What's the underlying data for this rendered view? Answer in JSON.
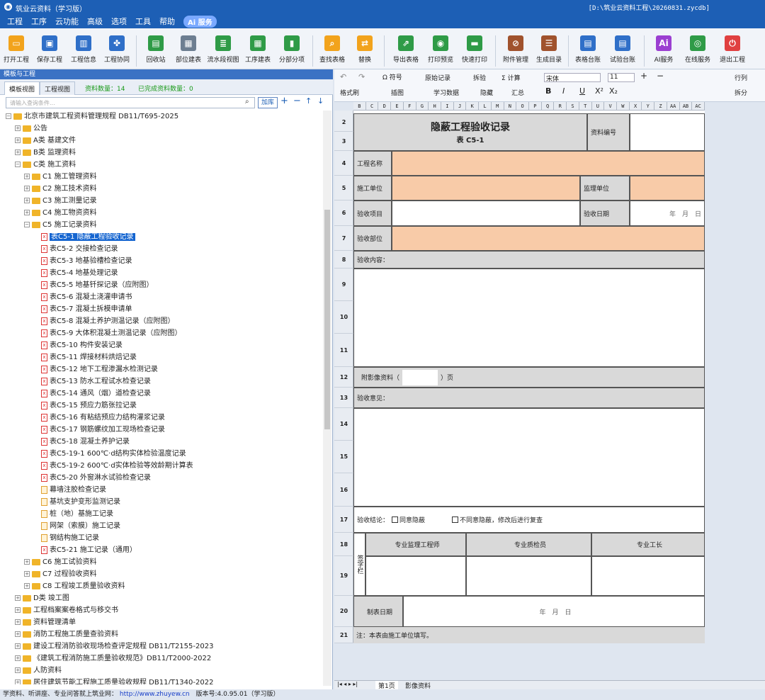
{
  "titlebar": {
    "title": "筑业云资料（学习版）",
    "path": "[D:\\筑业云资料工程\\20260831.zycdb]"
  },
  "menu": [
    "工程",
    "工序",
    "云功能",
    "高级",
    "选项",
    "工具",
    "帮助"
  ],
  "menu_ai": "Ai 服务",
  "toolbar": [
    {
      "label": "打开工程",
      "color": "#f2a31c",
      "icon": "folder-open-icon"
    },
    {
      "label": "保存工程",
      "color": "#2f6fc8",
      "icon": "save-icon"
    },
    {
      "label": "工程信息",
      "color": "#2f6fc8",
      "icon": "building-icon"
    },
    {
      "label": "工程协同",
      "color": "#2f6fc8",
      "icon": "handshake-icon"
    },
    {
      "label": "回收站",
      "color": "#2f9b47",
      "icon": "trash-icon"
    },
    {
      "label": "部位建表",
      "color": "#6d7e91",
      "icon": "table-part-icon"
    },
    {
      "label": "流水段视图",
      "color": "#2f9b47",
      "icon": "flow-view-icon"
    },
    {
      "label": "工序建表",
      "color": "#2f9b47",
      "icon": "process-table-icon"
    },
    {
      "label": "分部分项",
      "color": "#2f9b47",
      "icon": "chart-icon"
    },
    {
      "label": "查找表格",
      "color": "#f2a31c",
      "icon": "search-icon"
    },
    {
      "label": "替换",
      "color": "#f2a31c",
      "icon": "replace-icon"
    },
    {
      "label": "导出表格",
      "color": "#2f9b47",
      "icon": "export-icon"
    },
    {
      "label": "打印预览",
      "color": "#2f9b47",
      "icon": "print-preview-icon"
    },
    {
      "label": "快速打印",
      "color": "#2f9b47",
      "icon": "printer-icon"
    },
    {
      "label": "附件管理",
      "color": "#a0522d",
      "icon": "attachment-icon"
    },
    {
      "label": "生成目录",
      "color": "#a0522d",
      "icon": "catalog-icon"
    },
    {
      "label": "表格台账",
      "color": "#2f6fc8",
      "icon": "ledger-icon"
    },
    {
      "label": "试验台账",
      "color": "#2f6fc8",
      "icon": "test-ledger-icon"
    },
    {
      "label": "AI服务",
      "color": "#9b3fd1",
      "icon": "ai-icon"
    },
    {
      "label": "在线服务",
      "color": "#2f9b47",
      "icon": "online-service-icon"
    },
    {
      "label": "退出工程",
      "color": "#e04040",
      "icon": "power-icon"
    }
  ],
  "left_panel": {
    "header": "模板与工程",
    "tab_template": "模板视图",
    "tab_project": "工程视图",
    "count_label": "资料数量：14",
    "done_label": "已完成资料数量：0",
    "search_placeholder": "请输入查询条件...",
    "add_button": "加库"
  },
  "tree": [
    {
      "label": "北京市建筑工程资料管理规程 DB11/T695-2025",
      "level": 0,
      "type": "folder",
      "open": true
    },
    {
      "label": "公告",
      "level": 1,
      "type": "folder"
    },
    {
      "label": "A类 基建文件",
      "level": 1,
      "type": "folder"
    },
    {
      "label": "B类 监理资料",
      "level": 1,
      "type": "folder"
    },
    {
      "label": "C类 施工资料",
      "level": 1,
      "type": "folder",
      "open": true
    },
    {
      "label": "C1 施工管理资料",
      "level": 2,
      "type": "folder"
    },
    {
      "label": "C2 施工技术资料",
      "level": 2,
      "type": "folder"
    },
    {
      "label": "C3 施工测量记录",
      "level": 2,
      "type": "folder"
    },
    {
      "label": "C4 施工物资资料",
      "level": 2,
      "type": "folder"
    },
    {
      "label": "C5 施工记录资料",
      "level": 2,
      "type": "folder",
      "open": true
    },
    {
      "label": "表C5-1 隐蔽工程验收记录",
      "level": 3,
      "type": "doc",
      "selected": true
    },
    {
      "label": "表C5-2 交接检查记录",
      "level": 3,
      "type": "doc"
    },
    {
      "label": "表C5-3 地基验槽检查记录",
      "level": 3,
      "type": "doc"
    },
    {
      "label": "表C5-4 地基处理记录",
      "level": 3,
      "type": "doc"
    },
    {
      "label": "表C5-5 地基钎探记录（应附图）",
      "level": 3,
      "type": "doc"
    },
    {
      "label": "表C5-6 混凝土浇灌申请书",
      "level": 3,
      "type": "doc"
    },
    {
      "label": "表C5-7 混凝土拆模申请单",
      "level": 3,
      "type": "doc"
    },
    {
      "label": "表C5-8 混凝土养护测温记录（应附图）",
      "level": 3,
      "type": "doc"
    },
    {
      "label": "表C5-9 大体积混凝土测温记录（应附图）",
      "level": 3,
      "type": "doc"
    },
    {
      "label": "表C5-10 构件安装记录",
      "level": 3,
      "type": "doc"
    },
    {
      "label": "表C5-11 焊接材料烘焙记录",
      "level": 3,
      "type": "doc"
    },
    {
      "label": "表C5-12 地下工程渗漏水检测记录",
      "level": 3,
      "type": "doc"
    },
    {
      "label": "表C5-13 防水工程试水检查记录",
      "level": 3,
      "type": "doc"
    },
    {
      "label": "表C5-14 通风（烟）道检查记录",
      "level": 3,
      "type": "doc"
    },
    {
      "label": "表C5-15 预应力筋张拉记录",
      "level": 3,
      "type": "doc"
    },
    {
      "label": "表C5-16 有粘结预应力结构灌浆记录",
      "level": 3,
      "type": "doc"
    },
    {
      "label": "表C5-17 钢筋螺纹加工现场检查记录",
      "level": 3,
      "type": "doc"
    },
    {
      "label": "表C5-18 混凝土养护记录",
      "level": 3,
      "type": "doc"
    },
    {
      "label": "表C5-19-1 600℃·d结构实体检验温度记录",
      "level": 3,
      "type": "doc"
    },
    {
      "label": "表C5-19-2 600℃·d实体检验等效龄期计算表",
      "level": 3,
      "type": "doc"
    },
    {
      "label": "表C5-20 外窗淋水试验检查记录",
      "level": 3,
      "type": "doc"
    },
    {
      "label": "幕墙注胶检查记录",
      "level": 3,
      "type": "doco"
    },
    {
      "label": "基坑支护变形监测记录",
      "level": 3,
      "type": "doco"
    },
    {
      "label": "桩（地）基施工记录",
      "level": 3,
      "type": "doco"
    },
    {
      "label": "网架（索膜）施工记录",
      "level": 3,
      "type": "doco"
    },
    {
      "label": "钢结构施工记录",
      "level": 3,
      "type": "doco"
    },
    {
      "label": "表C5-21 施工记录（通用）",
      "level": 3,
      "type": "doc"
    },
    {
      "label": "C6 施工试验资料",
      "level": 2,
      "type": "folder"
    },
    {
      "label": "C7 过程验收资料",
      "level": 2,
      "type": "folder"
    },
    {
      "label": "C8 工程竣工质量验收资料",
      "level": 2,
      "type": "folder"
    },
    {
      "label": "D类 竣工图",
      "level": 1,
      "type": "folder"
    },
    {
      "label": "工程档案案卷格式与移交书",
      "level": 1,
      "type": "folder"
    },
    {
      "label": "资料管理清单",
      "level": 1,
      "type": "folder"
    },
    {
      "label": "消防工程施工质量查验资料",
      "level": 1,
      "type": "folder"
    },
    {
      "label": "建设工程消防验收现场检查评定规程 DB11/T2155-2023",
      "level": 1,
      "type": "folder"
    },
    {
      "label": "《建筑工程消防施工质量验收规范》DB11/T2000-2022",
      "level": 1,
      "type": "folder"
    },
    {
      "label": "人防资料",
      "level": 1,
      "type": "folder"
    },
    {
      "label": "居住建筑节能工程施工质量验收规程 DB11/T1340-2022",
      "level": 1,
      "type": "folder"
    }
  ],
  "rtool": {
    "symbol": "符号",
    "original": "原始记录",
    "split": "拆验",
    "calc": "计算",
    "font": "宋体",
    "size": "11",
    "format_brush": "格式刷",
    "insert_image": "插图",
    "study_data": "学习数据",
    "hide": "隐藏",
    "summary": "汇总",
    "row_col": "行列",
    "split_view": "拆分"
  },
  "columns": [
    "B",
    "C",
    "D",
    "E",
    "F",
    "G",
    "H",
    "I",
    "J",
    "K",
    "L",
    "M",
    "N",
    "O",
    "P",
    "Q",
    "R",
    "S",
    "T",
    "U",
    "V",
    "W",
    "X",
    "Y",
    "Z",
    "AA",
    "AB",
    "AC"
  ],
  "rows": [
    "2",
    "3",
    "4",
    "5",
    "6",
    "7",
    "8",
    "9",
    "10",
    "11",
    "12",
    "13",
    "14",
    "15",
    "16",
    "17",
    "18",
    "19",
    "20",
    "21"
  ],
  "form": {
    "title": "隐蔽工程验收记录",
    "subtitle": "表 C5-1",
    "doc_no": "资料编号",
    "project_name": "工程名称",
    "construction_unit": "施工单位",
    "supervision_unit": "监理单位",
    "inspection_item": "验收项目",
    "inspection_date": "验收日期",
    "date_placeholder": "年　月　日",
    "inspection_part": "验收部位",
    "inspection_content": "验收内容：",
    "attached_images": "附影像资料（",
    "pages": "）页",
    "inspection_opinion": "验收意见：",
    "conclusion": "验收结论：",
    "agree": "同意隐蔽",
    "disagree": "不同意隐蔽，修改后进行复查",
    "sign_column": "签字栏",
    "supervisor": "专业监理工程师",
    "quality_inspector": "专业质检员",
    "foreman": "专业工长",
    "fill_date": "制表日期",
    "note": "注：本表由施工单位填写。"
  },
  "sheet_tabs": [
    "第1页",
    "影像资料"
  ],
  "status": {
    "text": "学资料、听讲座、专业问答就上筑业网：",
    "url": "http://www.zhuyew.cn",
    "version": "版本号:4.0.95.01（学习版）"
  }
}
